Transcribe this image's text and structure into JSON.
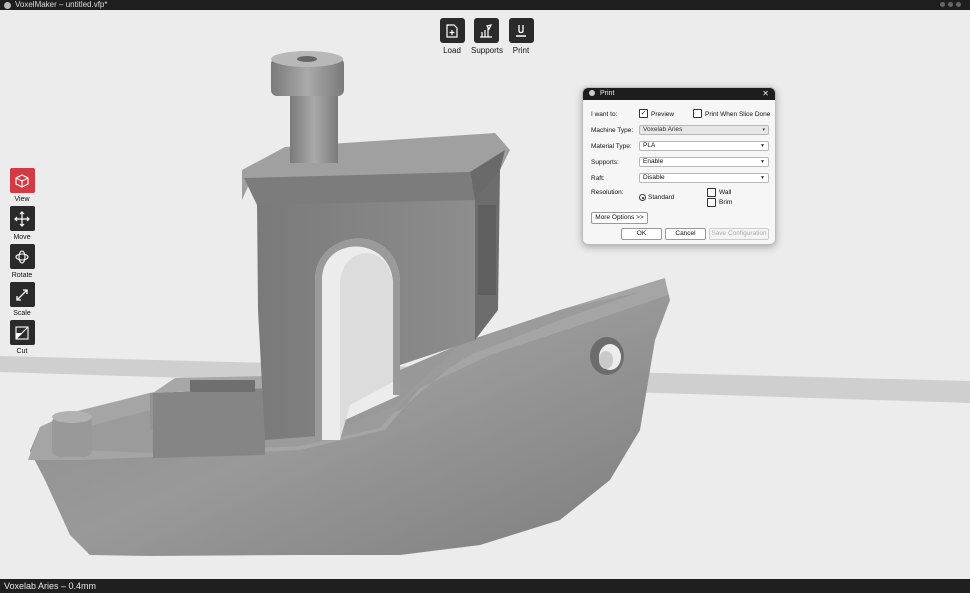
{
  "window": {
    "title": "VoxelMaker – untitled.vfp*"
  },
  "top_toolbar": [
    {
      "key": "load",
      "label": "Load",
      "icon": "load-icon"
    },
    {
      "key": "supports",
      "label": "Supports",
      "icon": "supports-icon"
    },
    {
      "key": "print",
      "label": "Print",
      "icon": "print-icon"
    }
  ],
  "left_toolbar": [
    {
      "key": "view",
      "label": "View",
      "icon": "view-cube-icon",
      "active": true
    },
    {
      "key": "move",
      "label": "Move",
      "icon": "move-icon"
    },
    {
      "key": "rotate",
      "label": "Rotate",
      "icon": "rotate-icon"
    },
    {
      "key": "scale",
      "label": "Scale",
      "icon": "scale-icon"
    },
    {
      "key": "cut",
      "label": "Cut",
      "icon": "cut-icon"
    }
  ],
  "status": {
    "text": "Voxelab Aries – 0.4mm"
  },
  "print_dialog": {
    "title": "Print",
    "i_want_to_label": "I want to:",
    "preview_label": "Preview",
    "preview_checked": true,
    "print_when_done_label": "Print When Slice Done",
    "print_when_done_checked": false,
    "machine_type_label": "Machine Type:",
    "machine_type_value": "Voxelab Aries",
    "material_type_label": "Material Type:",
    "material_type_value": "PLA",
    "supports_label": "Supports:",
    "supports_value": "Enable",
    "raft_label": "Raft:",
    "raft_value": "Disable",
    "resolution_label": "Resolution:",
    "resolution_value": "Standard",
    "wall_label": "Wall",
    "brim_label": "Brim",
    "more_options_label": "More Options >>",
    "ok_label": "OK",
    "cancel_label": "Cancel",
    "save_config_label": "Save Configuration"
  },
  "colors": {
    "accent": "#d43a44",
    "toolbar_button": "#2a2a2a",
    "model_gray": "#8c8c8c",
    "background": "#ececec"
  }
}
